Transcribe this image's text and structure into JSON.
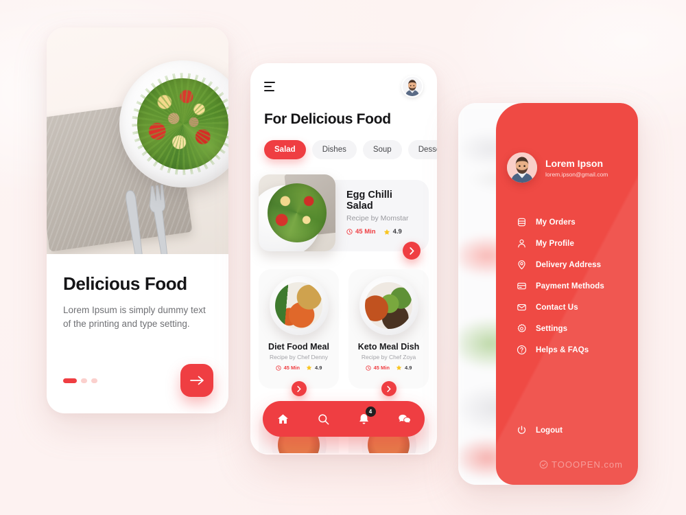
{
  "theme": {
    "accent": "#ef3e42",
    "drawer_bg": "#ef4a44",
    "page_bg": "#fdf3f2",
    "text_dark": "#151517",
    "text_muted": "#6f7074",
    "badge_bg": "#231f20"
  },
  "onboarding": {
    "title": "Delicious Food",
    "subtitle": "Lorem Ipsum is simply dummy text of the printing and type setting.",
    "hero_image_alt": "salad-bowl-photo",
    "pagination": {
      "total": 3,
      "active": 1
    },
    "next_label": "→"
  },
  "home": {
    "menu_icon": "hamburger-icon",
    "avatar_alt": "user-avatar",
    "heading": "For Delicious Food",
    "chips": [
      {
        "label": "Salad",
        "active": true
      },
      {
        "label": "Dishes",
        "active": false
      },
      {
        "label": "Soup",
        "active": false
      },
      {
        "label": "Dessert",
        "active": false
      }
    ],
    "featured": {
      "title": "Egg Chilli Salad",
      "author": "Recipe by Momstar",
      "time": "45 Min",
      "rating": "4.9",
      "time_icon": "clock-icon",
      "rating_icon": "star-icon",
      "go_label": "›"
    },
    "cards": [
      {
        "title": "Diet Food Meal",
        "author": "Recipe by Chef Denny",
        "time": "45 Min",
        "rating": "4.9",
        "go_label": "›"
      },
      {
        "title": "Keto Meal Dish",
        "author": "Recipe by Chef Zoya",
        "time": "45 Min",
        "rating": "4.9",
        "go_label": "›"
      }
    ],
    "nav": [
      {
        "name": "home-icon",
        "active": true,
        "badge": ""
      },
      {
        "name": "search-icon",
        "active": false,
        "badge": ""
      },
      {
        "name": "bell-icon",
        "active": false,
        "badge": "4"
      },
      {
        "name": "chat-icon",
        "active": false,
        "badge": ""
      }
    ]
  },
  "drawer": {
    "user": {
      "name": "Lorem Ipson",
      "email": "lorem.ipson@gmail.com",
      "avatar_alt": "drawer-user-avatar"
    },
    "items": [
      {
        "label": "My Orders",
        "icon": "orders-icon"
      },
      {
        "label": "My Profile",
        "icon": "person-icon"
      },
      {
        "label": "Delivery Address",
        "icon": "location-pin-icon"
      },
      {
        "label": "Payment Methods",
        "icon": "credit-card-icon"
      },
      {
        "label": "Contact Us",
        "icon": "envelope-icon"
      },
      {
        "label": "Settings",
        "icon": "gear-icon"
      },
      {
        "label": "Helps & FAQs",
        "icon": "question-circle-icon"
      }
    ],
    "logout": {
      "label": "Logout",
      "icon": "power-icon"
    }
  },
  "watermark": {
    "text": "TOOOPEN.com"
  }
}
